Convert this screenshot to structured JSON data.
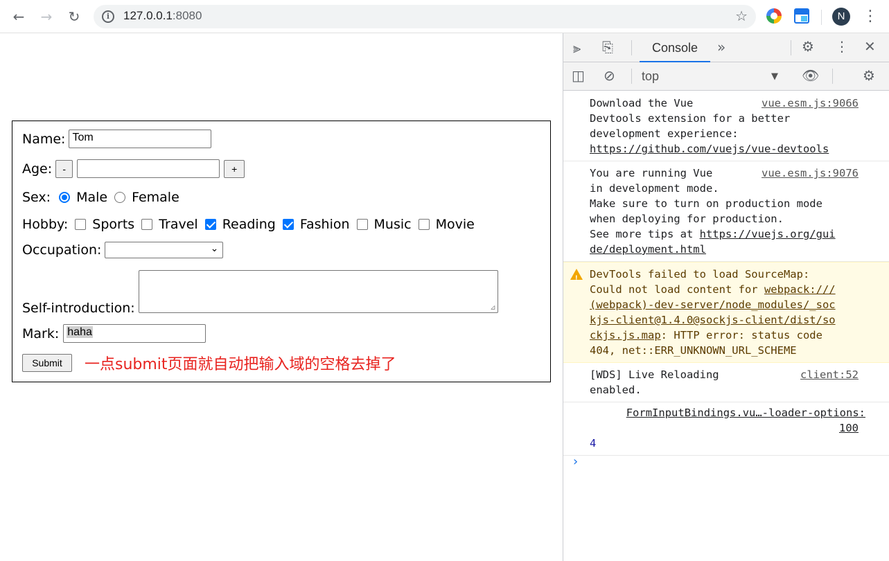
{
  "browser": {
    "url_host": "127.0.0.1",
    "url_port": ":8080",
    "profile_initial": "N"
  },
  "form": {
    "name_label": "Name:",
    "name_value": "Tom",
    "age_label": "Age:",
    "minus_label": "-",
    "plus_label": "+",
    "age_value": "",
    "sex_label": "Sex:",
    "sex_options": [
      {
        "label": "Male",
        "checked": true
      },
      {
        "label": "Female",
        "checked": false
      }
    ],
    "hobby_label": "Hobby:",
    "hobby_options": [
      {
        "label": "Sports",
        "checked": false
      },
      {
        "label": "Travel",
        "checked": false
      },
      {
        "label": "Reading",
        "checked": true
      },
      {
        "label": "Fashion",
        "checked": true
      },
      {
        "label": "Music",
        "checked": false
      },
      {
        "label": "Movie",
        "checked": false
      }
    ],
    "occupation_label": "Occupation:",
    "occupation_value": "",
    "intro_label": "Self-introduction:",
    "mark_label": "Mark:",
    "mark_value": "haha",
    "submit_label": "Submit",
    "annotation": "一点submit页面就自动把输入域的空格去掉了"
  },
  "devtools": {
    "tab_console": "Console",
    "context": "top",
    "messages": [
      {
        "text_lines": [
          "Download the Vue",
          "Devtools extension for a better",
          "development experience:"
        ],
        "link": "https://github.com/vuejs/vue-devtools",
        "source": "vue.esm.js:9066"
      },
      {
        "text_lines": [
          "You are running Vue",
          "in development mode.",
          "Make sure to turn on production mode",
          "when deploying for production.",
          "See more tips at "
        ],
        "link_line1": "https://vuejs.org/gui",
        "link_line2": "de/deployment.html",
        "source": "vue.esm.js:9076"
      },
      {
        "line1": "DevTools failed to load SourceMap:",
        "line2_prefix": "Could not load content for ",
        "link_a": "webpack:///",
        "link_b": "(webpack)-dev-server/node_modules/_soc",
        "link_c": "kjs-client@1.4.0@sockjs-client/dist/so",
        "link_d": "ckjs.js.map",
        "tail_d": ": HTTP error: status code",
        "line_e": "404, net::ERR_UNKNOWN_URL_SCHEME"
      },
      {
        "text_lines": [
          "[WDS] Live Reloading",
          "enabled."
        ],
        "source": "client:52"
      },
      {
        "source_a": "FormInputBindings.vu…-loader-options:",
        "source_b": "100",
        "value": "4"
      }
    ],
    "prompt": "›"
  }
}
